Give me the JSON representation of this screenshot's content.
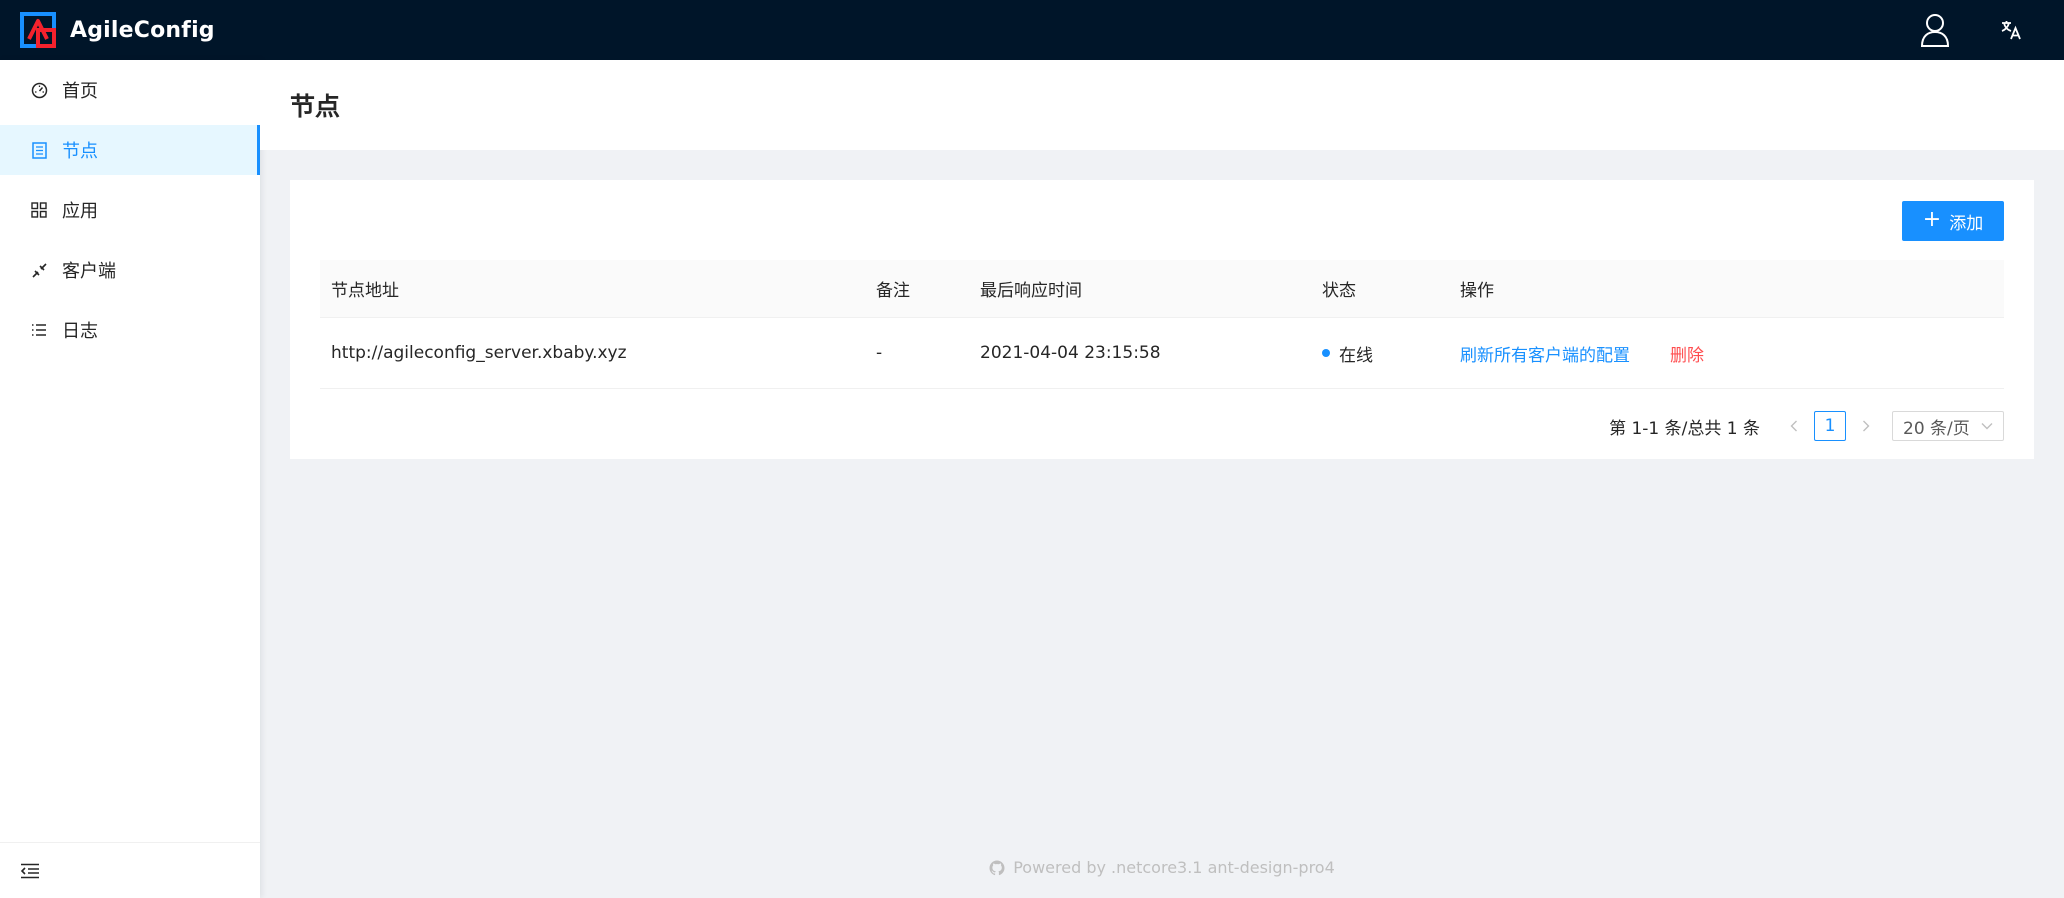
{
  "app": {
    "name": "AgileConfig",
    "colors": {
      "header_bg": "#001529",
      "primary": "#1890ff",
      "danger": "#ff4d4f",
      "active_bg": "#e6f7ff"
    },
    "header_icons": [
      "user-icon",
      "translate-icon"
    ]
  },
  "sidebar": {
    "items": [
      {
        "label": "首页",
        "icon": "dashboard-icon"
      },
      {
        "label": "节点",
        "icon": "node-list-icon",
        "active": true
      },
      {
        "label": "应用",
        "icon": "apps-grid-icon"
      },
      {
        "label": "客户端",
        "icon": "client-link-icon"
      },
      {
        "label": "日志",
        "icon": "log-list-icon"
      }
    ],
    "collapse_icon": "menu-fold-icon"
  },
  "page": {
    "title": "节点"
  },
  "toolbar": {
    "add_label": "添加"
  },
  "table": {
    "columns": [
      "节点地址",
      "备注",
      "最后响应时间",
      "状态",
      "操作"
    ],
    "rows": [
      {
        "address": "http://agileconfig_server.xbaby.xyz",
        "remark": "-",
        "last_response": "2021-04-04 23:15:58",
        "status": "在线",
        "actions": {
          "refresh": "刷新所有客户端的配置",
          "delete": "删除"
        }
      }
    ]
  },
  "pagination": {
    "total_text": "第 1-1 条/总共 1 条",
    "current_page": "1",
    "page_size": "20 条/页"
  },
  "footer": {
    "text": "Powered by .netcore3.1 ant-design-pro4"
  }
}
